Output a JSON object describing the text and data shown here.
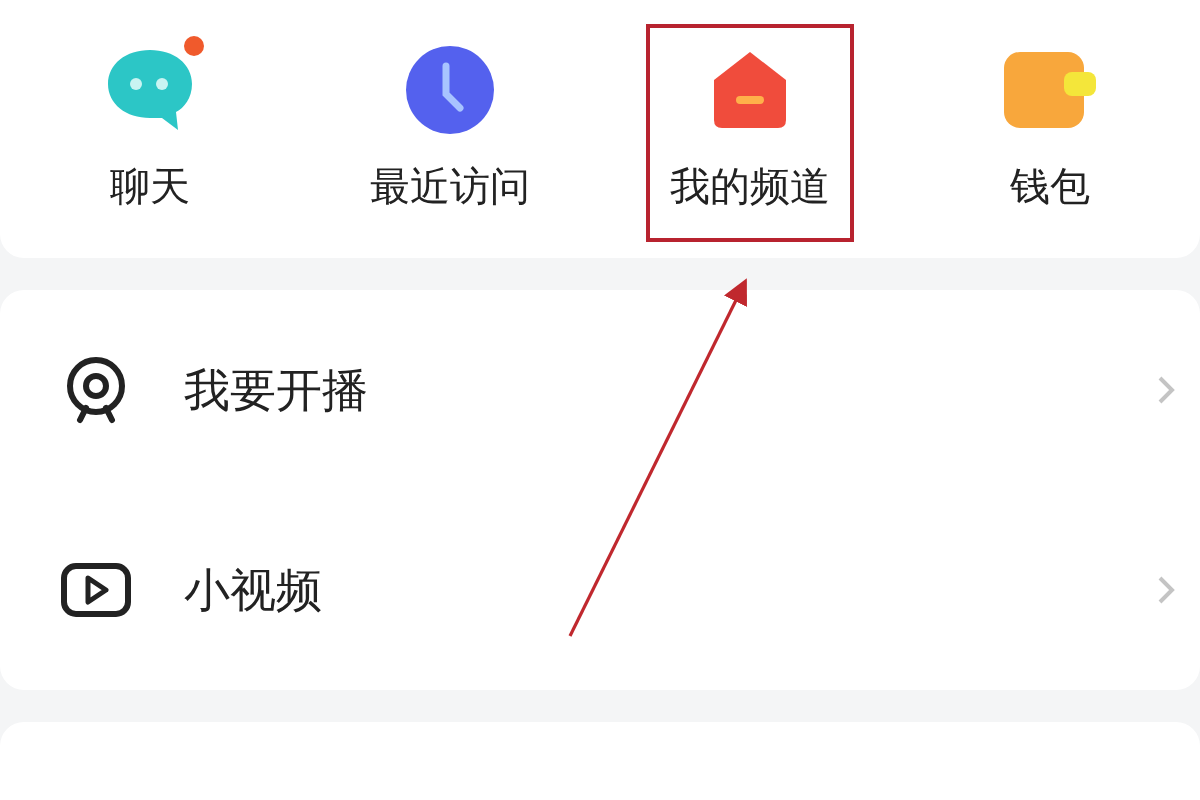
{
  "shortcuts": [
    {
      "label": "聊天",
      "kind": "chat",
      "badge": true,
      "highlighted": false
    },
    {
      "label": "最近访问",
      "kind": "clock",
      "badge": false,
      "highlighted": false
    },
    {
      "label": "我的频道",
      "kind": "channel",
      "badge": false,
      "highlighted": true
    },
    {
      "label": "钱包",
      "kind": "wallet",
      "badge": false,
      "highlighted": false
    }
  ],
  "menu": [
    {
      "label": "我要开播",
      "kind": "webcam"
    },
    {
      "label": "小视频",
      "kind": "video"
    }
  ]
}
